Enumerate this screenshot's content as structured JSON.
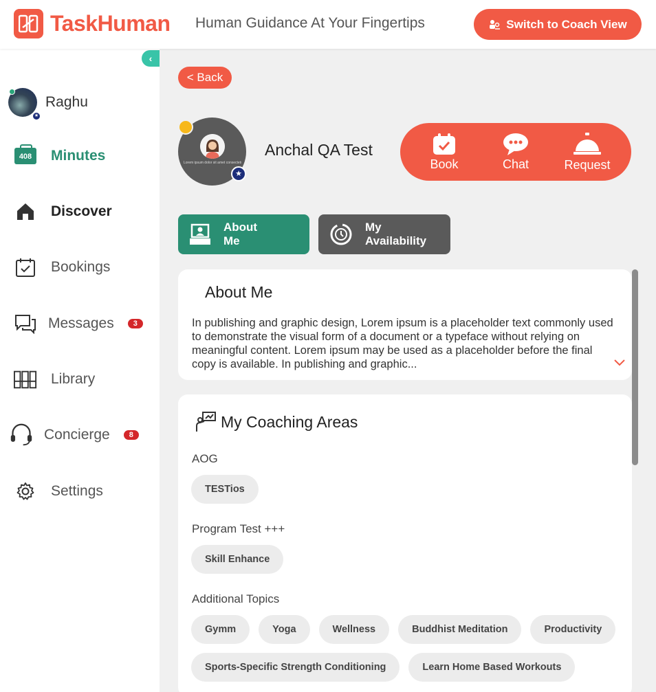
{
  "header": {
    "brand": "TaskHuman",
    "tagline": "Human Guidance At Your Fingertips",
    "switch_label": "Switch to Coach View"
  },
  "sidebar": {
    "collapse_icon": "chevron-left-icon",
    "user_name": "Raghu",
    "minutes_count": "408",
    "items": [
      {
        "label": "Minutes",
        "icon": "minutes-icon"
      },
      {
        "label": "Discover",
        "icon": "home-icon"
      },
      {
        "label": "Bookings",
        "icon": "calendar-check-icon"
      },
      {
        "label": "Messages",
        "icon": "chat-icon",
        "badge": "3"
      },
      {
        "label": "Library",
        "icon": "library-icon"
      },
      {
        "label": "Concierge",
        "icon": "headset-icon",
        "badge": "8"
      },
      {
        "label": "Settings",
        "icon": "gear-icon"
      }
    ]
  },
  "main": {
    "back_label": "< Back",
    "coach_name": "Anchal QA Test",
    "coach_avatar_caption": "Lorem ipsum dolor sit amet consectetur adipiscing elit",
    "actions": [
      {
        "label": "Book",
        "icon": "calendar-icon"
      },
      {
        "label": "Chat",
        "icon": "chat-bubble-icon"
      },
      {
        "label": "Request",
        "icon": "bell-icon"
      }
    ],
    "tabs": [
      {
        "line1": "About",
        "line2": "Me"
      },
      {
        "line1": "My",
        "line2": "Availability"
      }
    ],
    "about": {
      "title": "About Me",
      "text": "In publishing and graphic design, Lorem ipsum is a placeholder text commonly used to demonstrate the visual form of a document or a typeface without relying on meaningful content. Lorem ipsum may be used as a placeholder before the final copy is available. In publishing and graphic..."
    },
    "coaching": {
      "title": "My Coaching Areas",
      "sections": [
        {
          "label": "AOG",
          "chips": [
            "TESTios"
          ]
        },
        {
          "label": "Program Test +++",
          "chips": [
            "Skill Enhance"
          ]
        },
        {
          "label": "Additional Topics",
          "chips": [
            "Gymm",
            "Yoga",
            "Wellness",
            "Buddhist Meditation",
            "Productivity",
            "Sports-Specific Strength Conditioning",
            "Learn Home Based Workouts"
          ]
        }
      ]
    }
  },
  "colors": {
    "brand": "#f15a45",
    "accent_green": "#2a8f73",
    "teal": "#39c4a8",
    "badge_red": "#d4272a"
  }
}
